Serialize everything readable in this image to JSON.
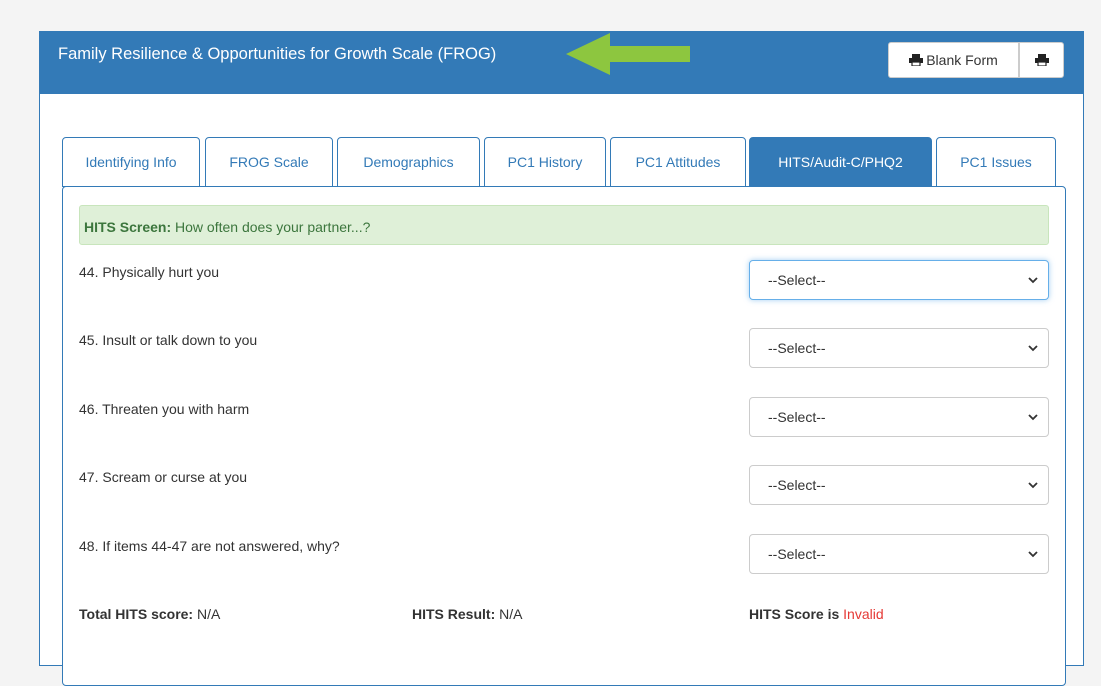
{
  "header": {
    "title": "Family Resilience & Opportunities for Growth Scale (FROG)",
    "blank_form_label": "Blank Form"
  },
  "colors": {
    "primary": "#337ab7",
    "arrow": "#8dc63f",
    "alert_bg": "#dff0d8",
    "invalid": "#e53935"
  },
  "tabs": [
    {
      "label": "Identifying Info",
      "active": false
    },
    {
      "label": "FROG Scale",
      "active": false
    },
    {
      "label": "Demographics",
      "active": false
    },
    {
      "label": "PC1 History",
      "active": false
    },
    {
      "label": "PC1 Attitudes",
      "active": false
    },
    {
      "label": "HITS/Audit-C/PHQ2",
      "active": true
    },
    {
      "label": "PC1 Issues",
      "active": false
    }
  ],
  "hits": {
    "screen_label": "HITS Screen:",
    "screen_text": " How often does your partner...?",
    "questions": [
      {
        "label": "44. Physically hurt you",
        "value": "--Select--"
      },
      {
        "label": "45. Insult or talk down to you",
        "value": "--Select--"
      },
      {
        "label": "46. Threaten you with harm",
        "value": "--Select--"
      },
      {
        "label": "47. Scream or curse at you",
        "value": "--Select--"
      },
      {
        "label": "48. If items 44-47 are not answered, why?",
        "value": "--Select--"
      }
    ],
    "total_label": "Total HITS score:",
    "total_value": " N/A",
    "result_label": "HITS Result:",
    "result_value": " N/A",
    "score_label": "HITS Score is",
    "score_status": "Invalid"
  },
  "icons": [
    "printer-icon",
    "printer-icon",
    "chevron-down-icon",
    "arrow-left-icon"
  ]
}
